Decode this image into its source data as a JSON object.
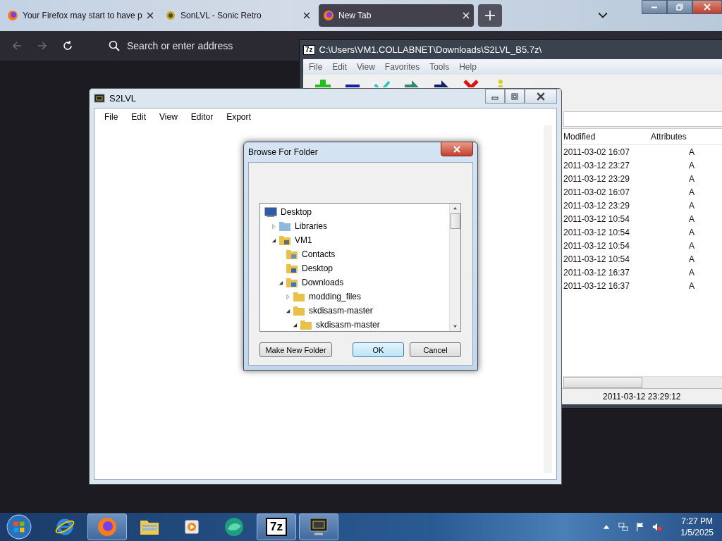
{
  "browser": {
    "tabs": [
      {
        "title": "Your Firefox may start to have p",
        "kind": "firefox",
        "selected": false
      },
      {
        "title": "SonLVL - Sonic Retro",
        "kind": "site",
        "selected": false
      },
      {
        "title": "New Tab",
        "kind": "firefox",
        "selected": true
      }
    ],
    "address_placeholder": "Search or enter address"
  },
  "archive_window": {
    "logo": "7z",
    "title": "C:\\Users\\VM1.COLLABNET\\Downloads\\S2LVL_B5.7z\\",
    "menu": [
      "File",
      "Edit",
      "View",
      "Favorites",
      "Tools",
      "Help"
    ],
    "columns": [
      "Modified",
      "Attributes"
    ],
    "rows": [
      {
        "modified": "2011-03-02 16:07",
        "attributes": "A"
      },
      {
        "modified": "2011-03-12 23:27",
        "attributes": "A"
      },
      {
        "modified": "2011-03-12 23:29",
        "attributes": "A"
      },
      {
        "modified": "2011-03-02 16:07",
        "attributes": "A"
      },
      {
        "modified": "2011-03-12 23:29",
        "attributes": "A"
      },
      {
        "modified": "2011-03-12 10:54",
        "attributes": "A"
      },
      {
        "modified": "2011-03-12 10:54",
        "attributes": "A"
      },
      {
        "modified": "2011-03-12 10:54",
        "attributes": "A"
      },
      {
        "modified": "2011-03-12 10:54",
        "attributes": "A"
      },
      {
        "modified": "2011-03-12 16:37",
        "attributes": "A"
      },
      {
        "modified": "2011-03-12 16:37",
        "attributes": "A"
      }
    ],
    "status": "2011-03-12 23:29:12"
  },
  "editor_window": {
    "title": "S2LVL",
    "menu": [
      "File",
      "Edit",
      "View",
      "Editor",
      "Export"
    ]
  },
  "dialog": {
    "title": "Browse For Folder",
    "tree": [
      {
        "label": "Desktop",
        "kind": "screen",
        "children": [
          {
            "label": "Libraries",
            "kind": "library",
            "expanded": false
          },
          {
            "label": "VM1",
            "kind": "user",
            "expanded": true,
            "children": [
              {
                "label": "Contacts",
                "kind": "contacts"
              },
              {
                "label": "Desktop",
                "kind": "desktop-folder"
              },
              {
                "label": "Downloads",
                "kind": "downloads",
                "expanded": true,
                "children": [
                  {
                    "label": "modding_files",
                    "kind": "folder",
                    "expanded": false
                  },
                  {
                    "label": "skdisasm-master",
                    "kind": "folder",
                    "expanded": true,
                    "children": [
                      {
                        "label": "skdisasm-master",
                        "kind": "folder",
                        "expanded": true
                      }
                    ]
                  }
                ]
              }
            ]
          }
        ]
      }
    ],
    "buttons": [
      {
        "label": "Make New Folder",
        "default": false
      },
      {
        "label": "OK",
        "default": true
      },
      {
        "label": "Cancel",
        "default": false
      }
    ]
  },
  "taskbar": {
    "apps": [
      {
        "kind": "ie",
        "active": false
      },
      {
        "kind": "firefox",
        "active": true
      },
      {
        "kind": "explorer",
        "active": false
      },
      {
        "kind": "media",
        "active": false
      },
      {
        "kind": "green-app",
        "active": false
      },
      {
        "kind": "sevenzip",
        "label": "7z",
        "active": true
      },
      {
        "kind": "monitor",
        "active": true
      }
    ],
    "time": "7:27 PM",
    "date": "1/5/2025"
  }
}
